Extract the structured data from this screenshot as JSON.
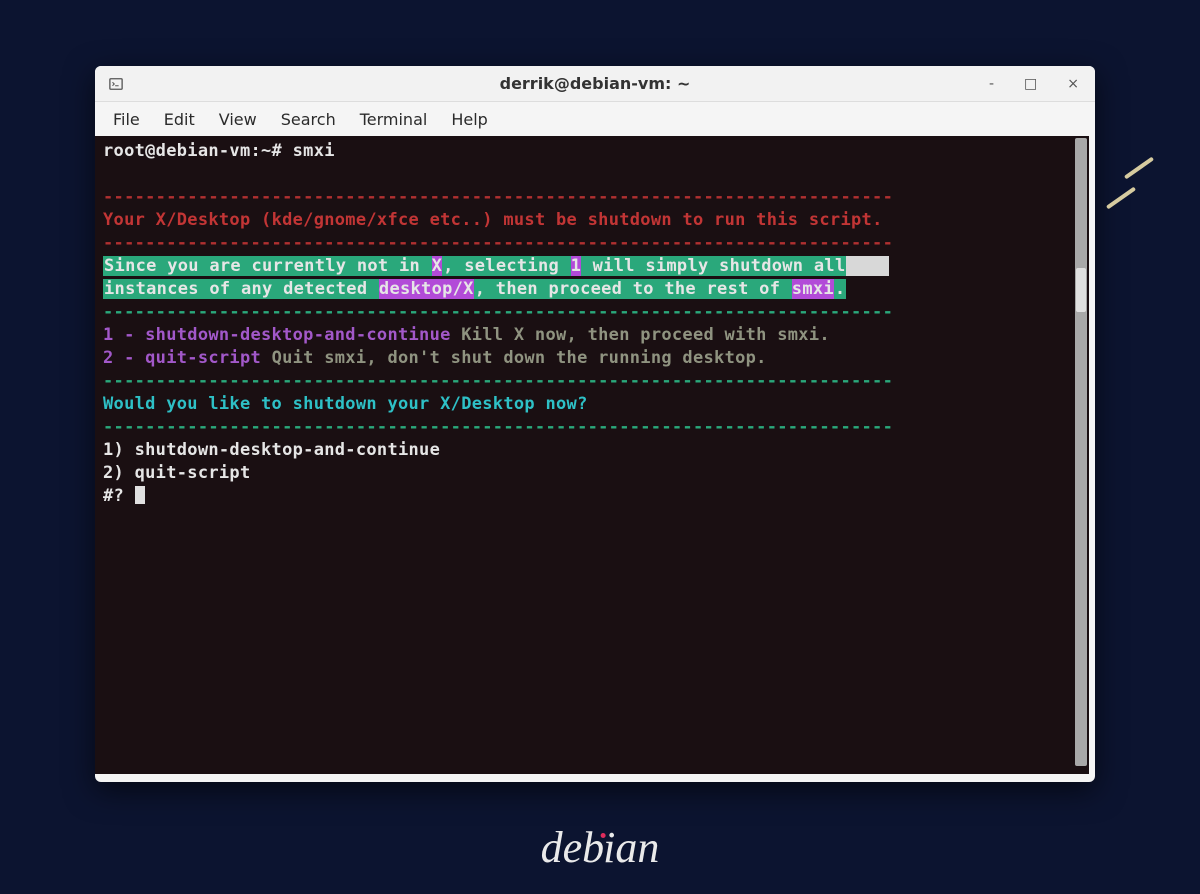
{
  "window": {
    "title": "derrik@debian-vm: ~"
  },
  "menu": {
    "file": "File",
    "edit": "Edit",
    "view": "View",
    "search": "Search",
    "terminal": "Terminal",
    "help": "Help"
  },
  "term": {
    "prompt_user": "root@debian-vm:~# ",
    "prompt_cmd": "smxi",
    "dashline_red": "---------------------------------------------------------------------------",
    "warn_a": "Your X/Desktop ",
    "warn_b": "(kde/gnome/xfce etc..)",
    "warn_c": " must be shutdown to run this script.",
    "info1_a": "Since you are currently not in ",
    "info1_x": "X",
    "info1_b": ", selecting ",
    "info1_1": "1",
    "info1_c": " will simply shutdown all",
    "info1_pad": "    ",
    "info2_a": "instances of any detected ",
    "info2_dx": "desktop/X",
    "info2_b": ", then proceed to the rest of ",
    "info2_smxi": "smxi",
    "info2_c": ".",
    "dashline_green": "---------------------------------------------------------------------------",
    "opt1_num": "1 - ",
    "opt1_name": "shutdown-desktop-and-continue",
    "opt1_desc": " Kill X now, then proceed with smxi.",
    "opt2_num": "2 - ",
    "opt2_name": "quit-script",
    "opt2_desc": " Quit smxi, don't shut down the running desktop.",
    "ask_a": "Would you like to shutdown your ",
    "ask_b": "X/Desktop",
    "ask_c": " now?",
    "choice1": "1) shutdown-desktop-and-continue",
    "choice2": "2) quit-script",
    "input_prompt": "#? "
  },
  "logo": {
    "text_left": "deb",
    "text_right": "ian"
  }
}
